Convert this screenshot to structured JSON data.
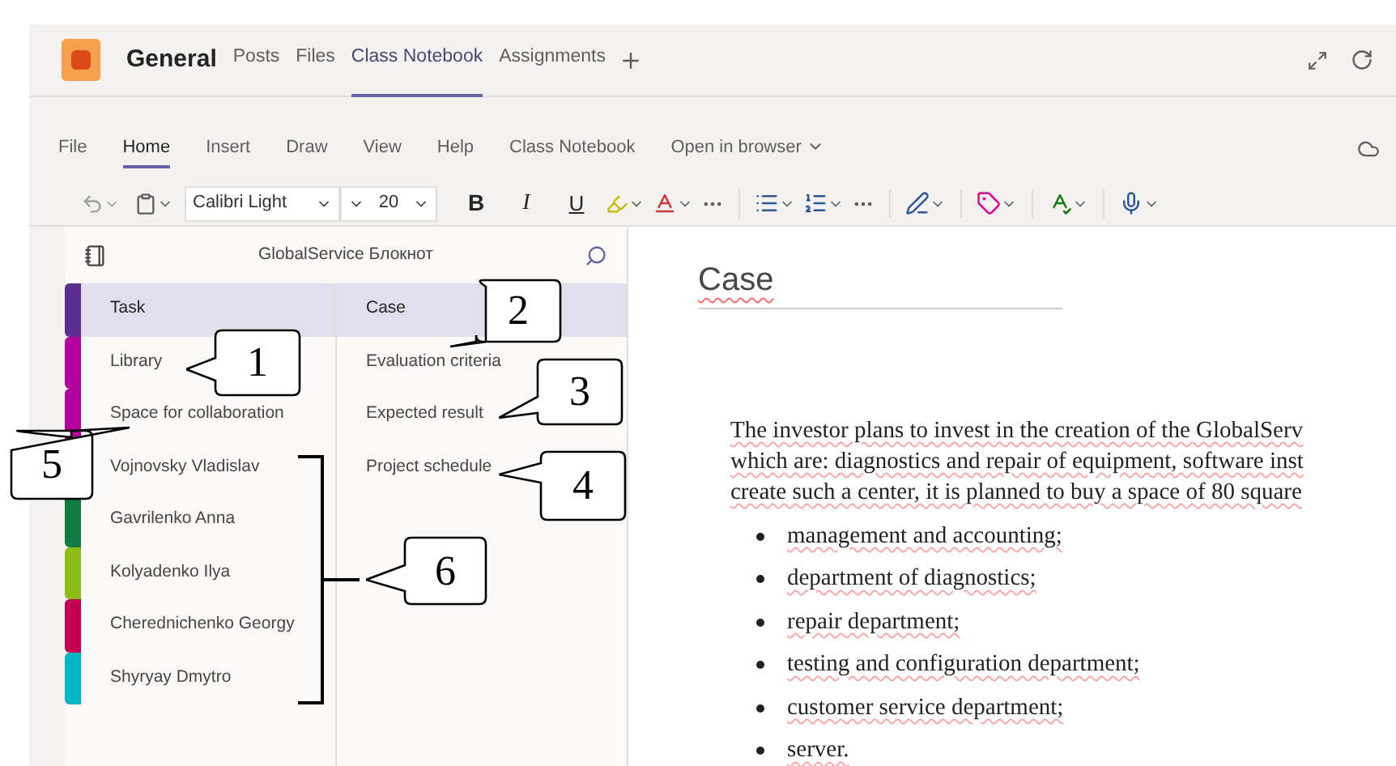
{
  "team": {
    "name": "General",
    "tabs": [
      {
        "label": "Posts",
        "selected": false
      },
      {
        "label": "Files",
        "selected": false
      },
      {
        "label": "Class Notebook",
        "selected": true
      },
      {
        "label": "Assignments",
        "selected": false
      }
    ]
  },
  "ribbon": {
    "tabs": [
      {
        "label": "File",
        "selected": false
      },
      {
        "label": "Home",
        "selected": true
      },
      {
        "label": "Insert",
        "selected": false
      },
      {
        "label": "Draw",
        "selected": false
      },
      {
        "label": "View",
        "selected": false
      },
      {
        "label": "Help",
        "selected": false
      },
      {
        "label": "Class Notebook",
        "selected": false
      }
    ],
    "open_in_browser": "Open in browser"
  },
  "toolbar": {
    "font": "Calibri Light",
    "size": "20",
    "bold": "B",
    "italic": "I",
    "underline": "U"
  },
  "notebook": {
    "title": "GlobalService Блокнот",
    "sections": [
      {
        "label": "Task",
        "color": "#5c2d91",
        "selected": true
      },
      {
        "label": "Library",
        "color": "#b4009e",
        "selected": false
      },
      {
        "label": "Space for collaboration",
        "color": "#b4009e",
        "selected": false
      },
      {
        "label": "Vojnovsky Vladislav",
        "selected": false
      },
      {
        "label": "Gavrilenko Anna",
        "color": "#107c41",
        "selected": false
      },
      {
        "label": "Kolyadenko Ilya",
        "color": "#8cbd18",
        "selected": false
      },
      {
        "label": "Cherednichenko Georgy",
        "color": "#c30052",
        "selected": false
      },
      {
        "label": "Shyryay Dmytro",
        "color": "#00b7c3",
        "selected": false
      }
    ],
    "pages": [
      {
        "label": "Case",
        "selected": true
      },
      {
        "label": "Evaluation criteria",
        "selected": false
      },
      {
        "label": "Expected result",
        "selected": false
      },
      {
        "label": "Project schedule",
        "selected": false
      }
    ]
  },
  "page": {
    "title": "Case",
    "paragraph_lines": [
      "The investor plans to invest in the creation of the GlobalServ",
      "which are: diagnostics and repair of equipment, software inst",
      "create such a center, it is planned to buy a space of 80 square"
    ],
    "bullets": [
      "management and accounting;",
      "department of diagnostics;",
      "repair department;",
      "testing and configuration department;",
      "customer service department;",
      "server."
    ]
  },
  "callouts": [
    {
      "label": "1"
    },
    {
      "label": "2"
    },
    {
      "label": "3"
    },
    {
      "label": "4"
    },
    {
      "label": "5"
    },
    {
      "label": "6"
    }
  ]
}
